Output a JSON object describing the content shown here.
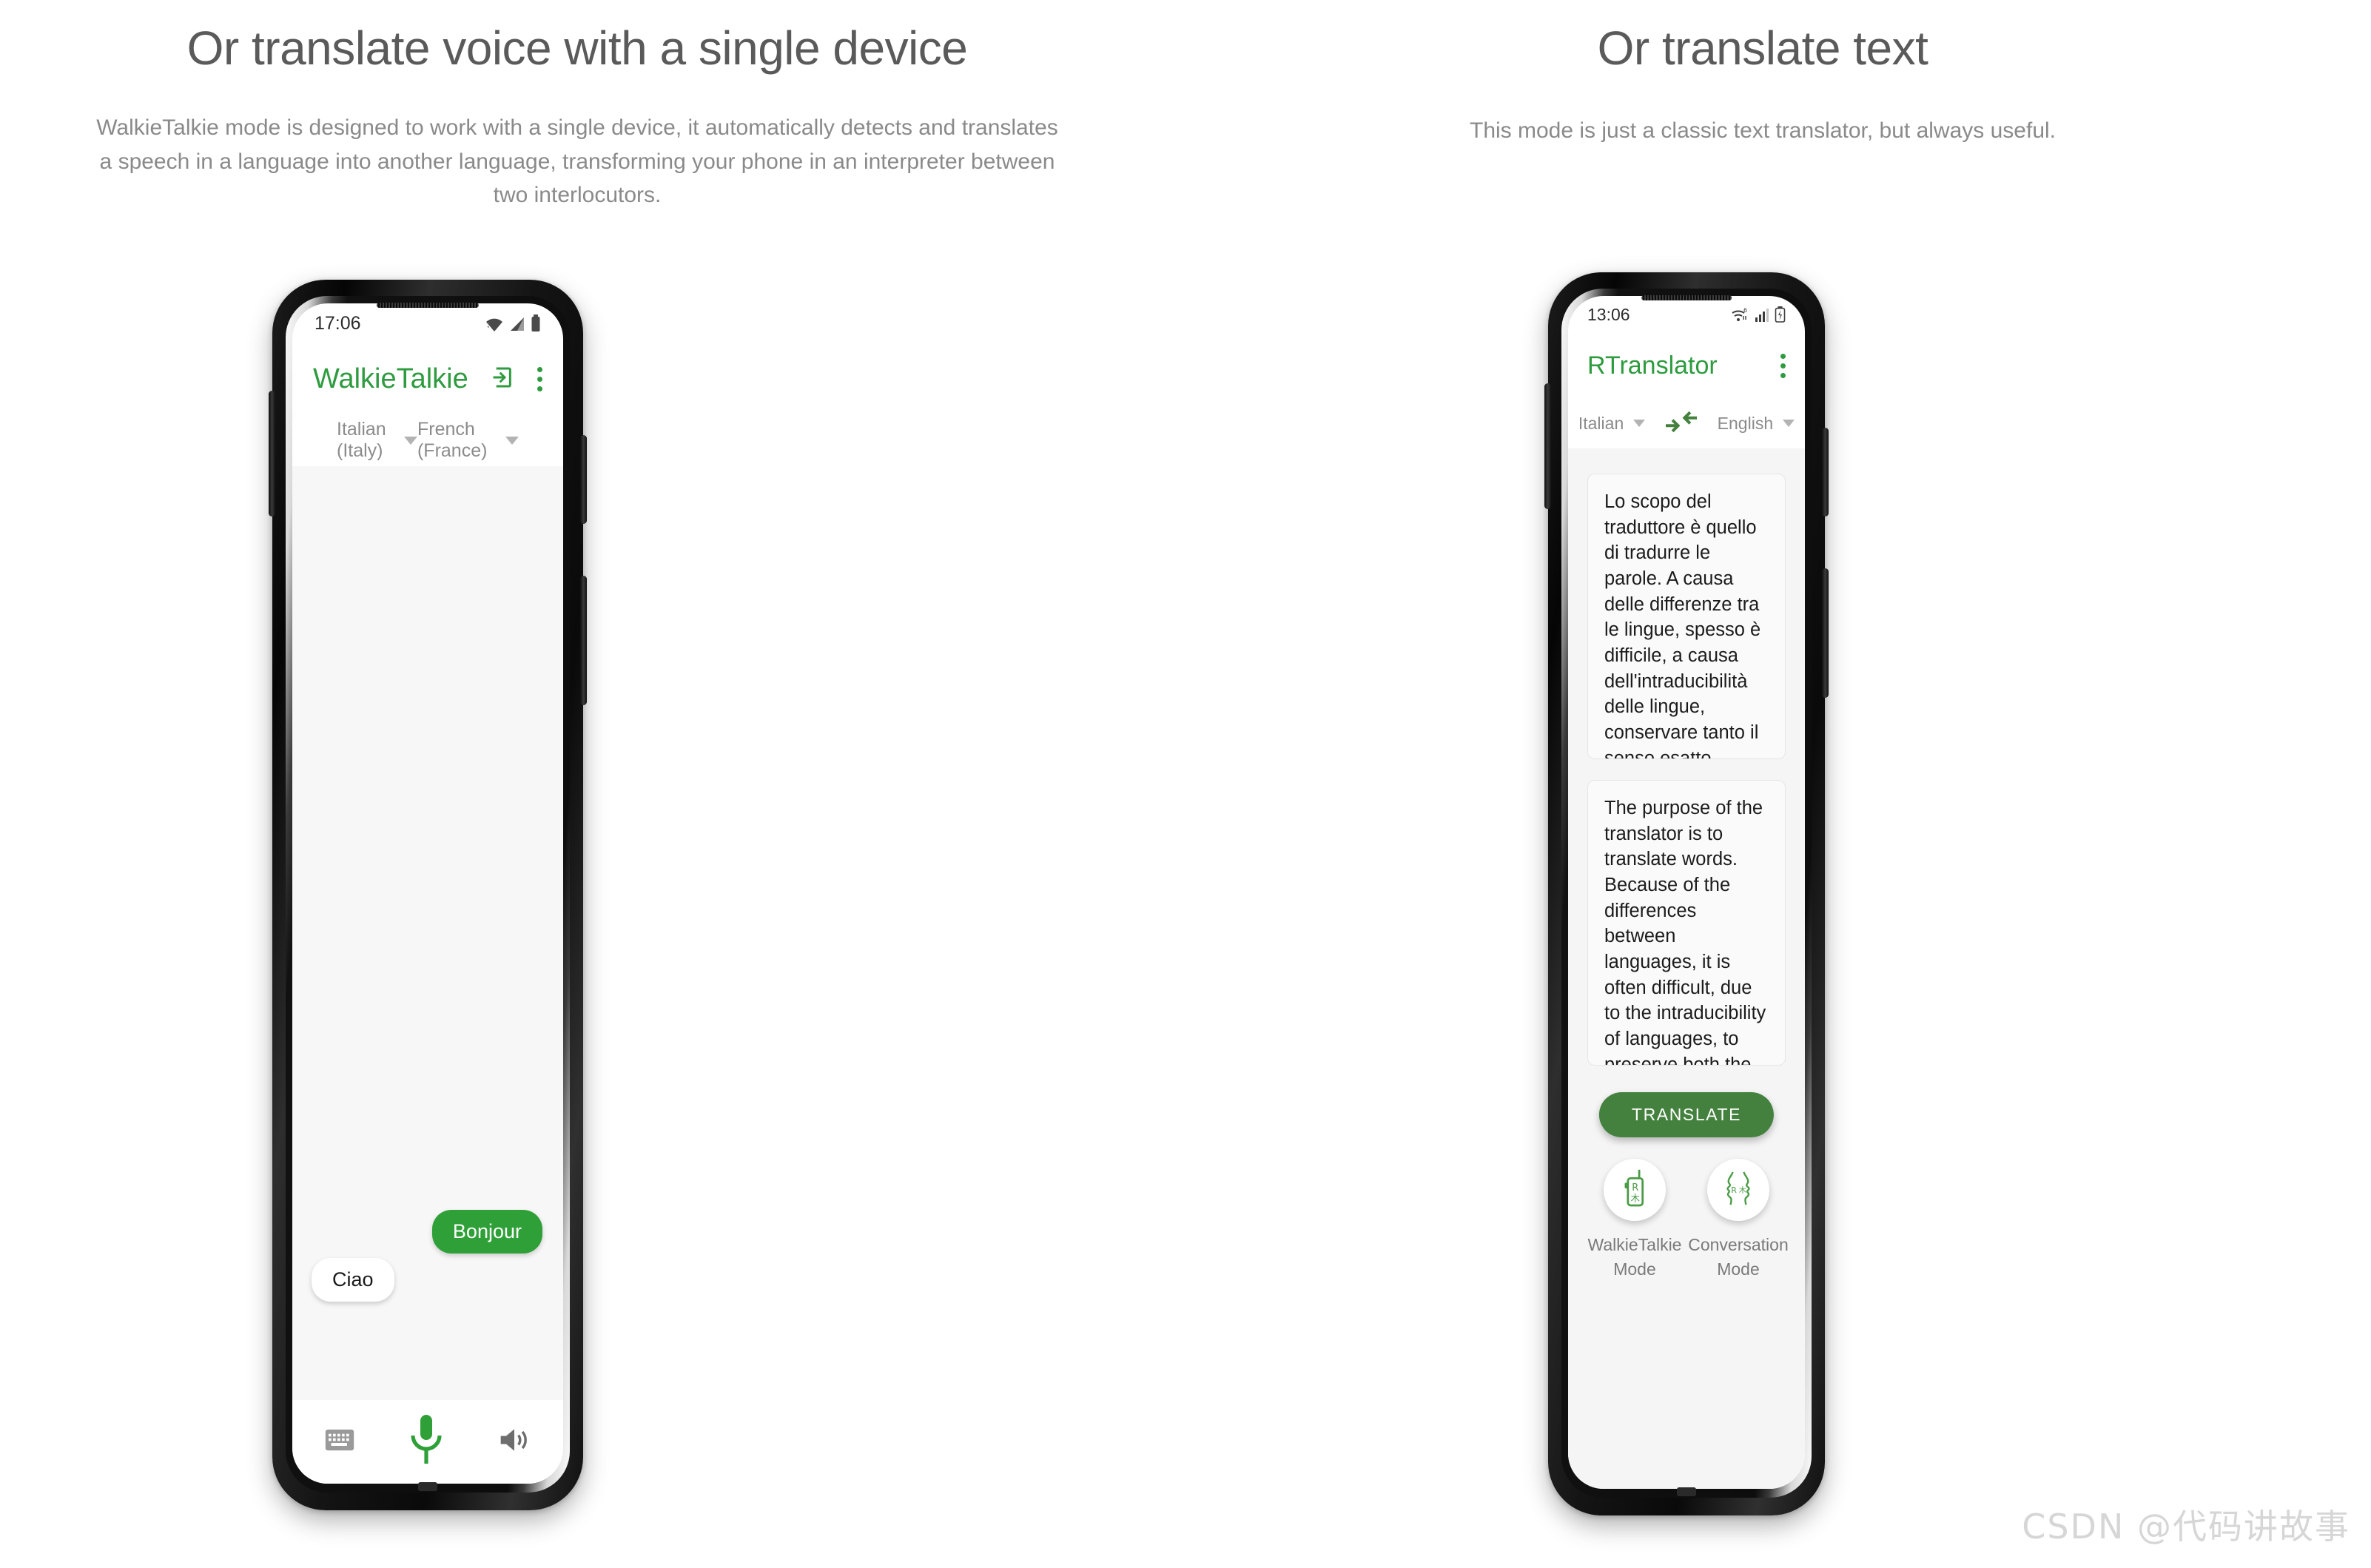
{
  "left_section": {
    "title": "Or translate voice with a single device",
    "subtitle": "WalkieTalkie mode is designed to work with a single device, it automatically detects and translates a speech in a language into another language, transforming your phone in an interpreter between two interlocutors."
  },
  "right_section": {
    "title": "Or translate text",
    "subtitle": "This mode is just a classic text translator, but always useful."
  },
  "phone_left": {
    "status_bar": {
      "time": "17:06",
      "icons": [
        "wifi-icon",
        "signal-icon",
        "battery-icon"
      ]
    },
    "app_bar": {
      "title": "WalkieTalkie",
      "actions": [
        "login-arrow-icon",
        "overflow-menu-icon"
      ]
    },
    "languages": {
      "source": "Italian (Italy)",
      "target": "French (France)"
    },
    "messages": [
      {
        "text": "Bonjour",
        "side": "outgoing"
      },
      {
        "text": "Ciao",
        "side": "incoming"
      }
    ],
    "bottom_bar": {
      "keyboard": "keyboard-icon",
      "mic": "microphone-icon",
      "speaker": "speaker-icon"
    },
    "accent_color": "#2FA038"
  },
  "phone_right": {
    "status_bar": {
      "time": "13:06",
      "icons": [
        "wifi-6-icon",
        "signal-icon",
        "battery-charging-icon"
      ]
    },
    "app_bar": {
      "title": "RTranslator",
      "actions": [
        "overflow-menu-icon"
      ]
    },
    "languages": {
      "source": "Italian",
      "target": "English",
      "swap": "swap-arrows-icon"
    },
    "source_text": "Lo scopo del traduttore è quello di tradurre le parole. A causa delle differenze tra le lingue, spesso è difficile, a causa dell'intraducibilità delle lingue, conservare tanto il senso esatto quanto lo stile della scrittura — il ritmo, il registro, il suono, la metrica — e il traduttore si trova costretto a operare scelte che cambiano in funzione della natura del testo stesso e degli scopi che la traduzione si prefigge.",
    "target_text": "The purpose of the translator is to translate words. Because of the differences between languages, it is often difficult, due to the intraducibility of languages, to preserve both the exact meaning and the style of writing  the rhythm, register, sound, metric  and the translator is forced to make choices that change depending on the nature of the text itself and the purposes that the translation sets itself.",
    "translate_button": "TRANSLATE",
    "modes": [
      {
        "label": "WalkieTalkie\nMode",
        "icon": "walkie-talkie-icon"
      },
      {
        "label": "Conversation\nMode",
        "icon": "two-faces-icon"
      }
    ],
    "accent_color": "#2E9B3F",
    "button_color": "#44813E"
  },
  "watermark": "CSDN @代码讲故事"
}
